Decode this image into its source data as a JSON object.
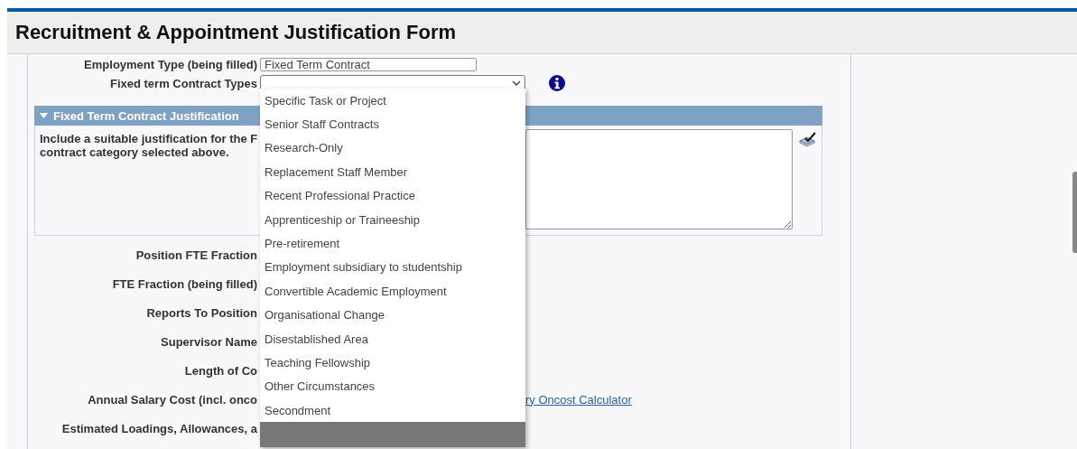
{
  "header": {
    "title": "Recruitment & Appointment Justification Form"
  },
  "employment_type": {
    "label": "Employment Type (being filled)",
    "value": "Fixed Term Contract"
  },
  "contract_types": {
    "label": "Fixed term Contract Types",
    "expanded": true,
    "options": [
      {
        "label": "Specific Task or Project",
        "selected": false
      },
      {
        "label": "Senior Staff Contracts",
        "selected": false
      },
      {
        "label": "Research-Only",
        "selected": false
      },
      {
        "label": "Replacement Staff Member",
        "selected": false
      },
      {
        "label": "Recent Professional Practice",
        "selected": false
      },
      {
        "label": "Apprenticeship or Traineeship",
        "selected": false
      },
      {
        "label": "Pre-retirement",
        "selected": false
      },
      {
        "label": "Employment subsidiary to studentship",
        "selected": false
      },
      {
        "label": "Convertible Academic Employment",
        "selected": false
      },
      {
        "label": "Organisational Change",
        "selected": false
      },
      {
        "label": "Disestablished Area",
        "selected": false
      },
      {
        "label": "Teaching Fellowship",
        "selected": false
      },
      {
        "label": "Other Circumstances",
        "selected": false
      },
      {
        "label": "Secondment",
        "selected": false
      }
    ],
    "blank_option": {
      "selected": true
    }
  },
  "section": {
    "title": "Fixed Term Contract Justification",
    "expanded": true,
    "instructions": [
      "Include a suitable justification for the F",
      "contract category selected above."
    ]
  },
  "rows": [
    {
      "label": "Position FTE Fraction"
    },
    {
      "label": "FTE Fraction (being filled)"
    },
    {
      "label": "Reports To Position"
    },
    {
      "label": "Supervisor Name"
    },
    {
      "label": "Length of Co"
    },
    {
      "label": "Annual Salary Cost (incl. onco",
      "link": "ry Oncost Calculator"
    },
    {
      "label": "Estimated Loadings, Allowances, a"
    }
  ]
}
